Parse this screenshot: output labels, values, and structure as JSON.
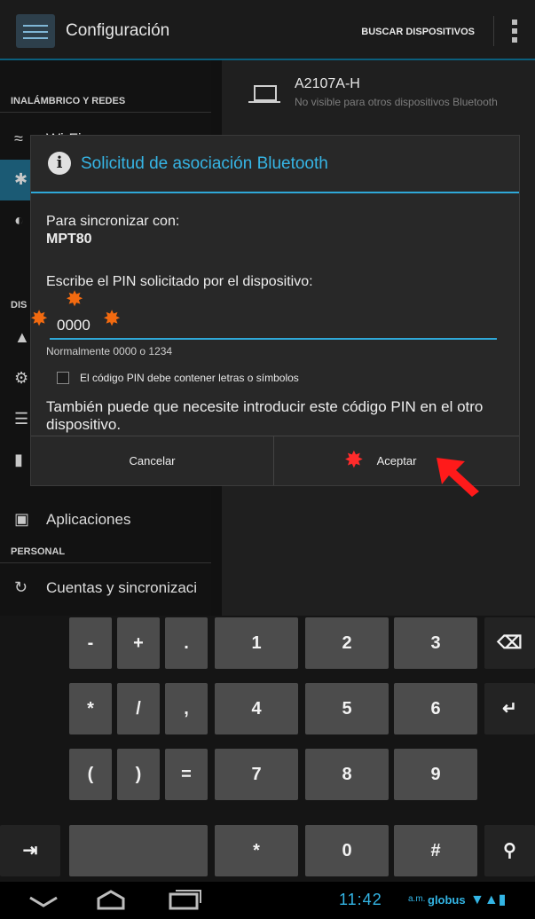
{
  "action_bar": {
    "title": "Configuración",
    "search_button": "BUSCAR DISPOSITIVOS",
    "overflow_icon": "vertical-dots-icon"
  },
  "settings": {
    "section_wireless": "INALÁMBRICO Y REDES",
    "section_device_partial": "DIS",
    "item_wifi": "Wi-Fi",
    "item_apps": "Aplicaciones",
    "section_personal": "PERSONAL",
    "item_accounts": "Cuentas y sincronizaci"
  },
  "bluetooth_device": {
    "name": "A2107A-H",
    "status": "No visible para otros dispositivos Bluetooth"
  },
  "dialog": {
    "title": "Solicitud de asociación Bluetooth",
    "sync_label": "Para sincronizar con:",
    "device_name": "MPT80",
    "pin_prompt": "Escribe el PIN solicitado por el dispositivo:",
    "pin_value": "0000",
    "pin_hint": "Normalmente 0000 o 1234",
    "pin_checkbox_label": "El código PIN debe contener letras o símbolos",
    "pin_checkbox_checked": false,
    "note": "También puede que necesite introducir este código PIN en el otro dispositivo.",
    "cancel_label": "Cancelar",
    "accept_label": "Aceptar"
  },
  "keyboard": {
    "row1": [
      "-",
      "+",
      ".",
      "1",
      "2",
      "3"
    ],
    "row2": [
      "*",
      "/",
      ",",
      "4",
      "5",
      "6"
    ],
    "row3": [
      "(",
      ")",
      "=",
      "7",
      "8",
      "9"
    ],
    "row4": [
      "*",
      "0",
      "#"
    ]
  },
  "status_bar": {
    "time": "11:42",
    "ampm": "a.m.",
    "carrier": "globus"
  },
  "colors": {
    "accent": "#33b5e5",
    "annotation_spark": "#f26a10",
    "annotation_arrow": "#ff1a1a"
  }
}
